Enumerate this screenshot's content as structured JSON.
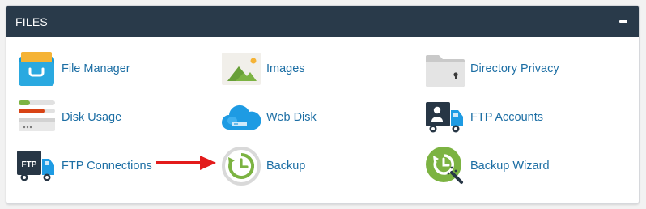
{
  "panel": {
    "title": "FILES",
    "collapse_icon": "minus-icon"
  },
  "items": [
    {
      "label": "File Manager",
      "icon": "file-manager-icon"
    },
    {
      "label": "Images",
      "icon": "images-icon"
    },
    {
      "label": "Directory Privacy",
      "icon": "directory-privacy-icon"
    },
    {
      "label": "Disk Usage",
      "icon": "disk-usage-icon"
    },
    {
      "label": "Web Disk",
      "icon": "web-disk-icon"
    },
    {
      "label": "FTP Accounts",
      "icon": "ftp-accounts-icon"
    },
    {
      "label": "FTP Connections",
      "icon": "ftp-connections-icon"
    },
    {
      "label": "Backup",
      "icon": "backup-icon"
    },
    {
      "label": "Backup Wizard",
      "icon": "backup-wizard-icon"
    }
  ],
  "icon_text": {
    "ftp_truck": "FTP"
  },
  "annotation": {
    "arrow_color": "#e31b1b",
    "arrow_points_to": "Backup"
  },
  "colors": {
    "header_bg": "#293a4a",
    "link": "#1c6ea4"
  }
}
